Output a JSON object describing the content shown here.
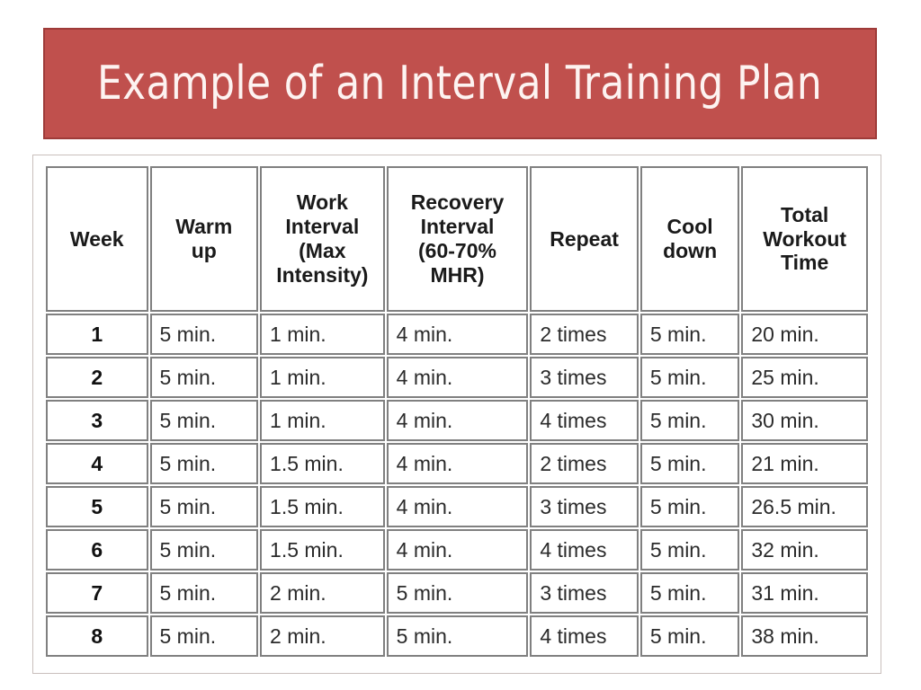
{
  "slide": {
    "title": "Example of an Interval Training Plan",
    "banner_fill": "#c0504d",
    "banner_border": "#9e3b39",
    "title_color": "#fdf3f1"
  },
  "table": {
    "frame_border": "#c9bfbc",
    "cell_border": "#808080",
    "headers": [
      {
        "key": "week",
        "lines": [
          "Week"
        ]
      },
      {
        "key": "warmup",
        "lines": [
          "Warm",
          "up"
        ]
      },
      {
        "key": "work",
        "lines": [
          "Work",
          "Interval",
          "(Max",
          "Intensity)"
        ]
      },
      {
        "key": "recovery",
        "lines": [
          "Recovery",
          "Interval",
          "(60-70%",
          "MHR)"
        ]
      },
      {
        "key": "repeat",
        "lines": [
          "Repeat"
        ]
      },
      {
        "key": "cool",
        "lines": [
          "Cool",
          "down"
        ]
      },
      {
        "key": "total",
        "lines": [
          "Total",
          "Workout",
          "Time"
        ]
      }
    ],
    "rows": [
      {
        "week": "1",
        "warmup": "5 min.",
        "work": "1 min.",
        "recovery": "4 min.",
        "repeat": "2 times",
        "cool": "5 min.",
        "total": "20 min."
      },
      {
        "week": "2",
        "warmup": "5 min.",
        "work": "1 min.",
        "recovery": "4 min.",
        "repeat": "3 times",
        "cool": "5 min.",
        "total": "25 min."
      },
      {
        "week": "3",
        "warmup": "5 min.",
        "work": "1 min.",
        "recovery": "4 min.",
        "repeat": "4 times",
        "cool": "5 min.",
        "total": "30 min."
      },
      {
        "week": "4",
        "warmup": "5 min.",
        "work": "1.5 min.",
        "recovery": "4 min.",
        "repeat": "2 times",
        "cool": "5 min.",
        "total": "21 min."
      },
      {
        "week": "5",
        "warmup": "5 min.",
        "work": "1.5 min.",
        "recovery": "4 min.",
        "repeat": "3 times",
        "cool": "5 min.",
        "total": "26.5 min."
      },
      {
        "week": "6",
        "warmup": "5 min.",
        "work": "1.5 min.",
        "recovery": "4 min.",
        "repeat": "4 times",
        "cool": "5 min.",
        "total": "32 min."
      },
      {
        "week": "7",
        "warmup": "5 min.",
        "work": "2 min.",
        "recovery": "5 min.",
        "repeat": "3 times",
        "cool": "5 min.",
        "total": "31 min."
      },
      {
        "week": "8",
        "warmup": "5 min.",
        "work": "2 min.",
        "recovery": "5 min.",
        "repeat": "4 times",
        "cool": "5 min.",
        "total": "38 min."
      }
    ]
  }
}
